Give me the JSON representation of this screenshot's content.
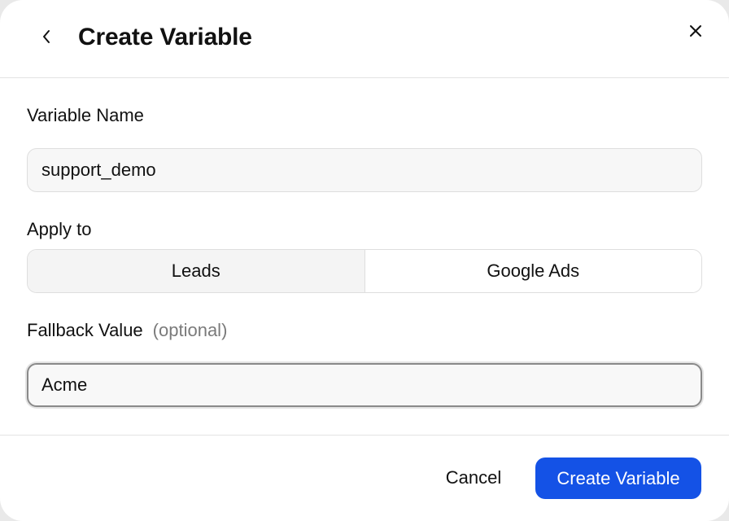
{
  "dialog": {
    "title": "Create Variable",
    "back_icon": "chevron-left-icon",
    "close_icon": "close-icon"
  },
  "fields": {
    "variable_name": {
      "label": "Variable Name",
      "value": "support_demo"
    },
    "apply_to": {
      "label": "Apply to",
      "options": [
        "Leads",
        "Google Ads"
      ],
      "selected": "Leads"
    },
    "fallback_value": {
      "label": "Fallback Value",
      "optional_label": "(optional)",
      "value": "Acme"
    }
  },
  "footer": {
    "cancel_label": "Cancel",
    "submit_label": "Create Variable"
  },
  "colors": {
    "primary": "#1452e6",
    "text": "#111111",
    "muted": "#7a7a7a",
    "border": "#dedede"
  }
}
